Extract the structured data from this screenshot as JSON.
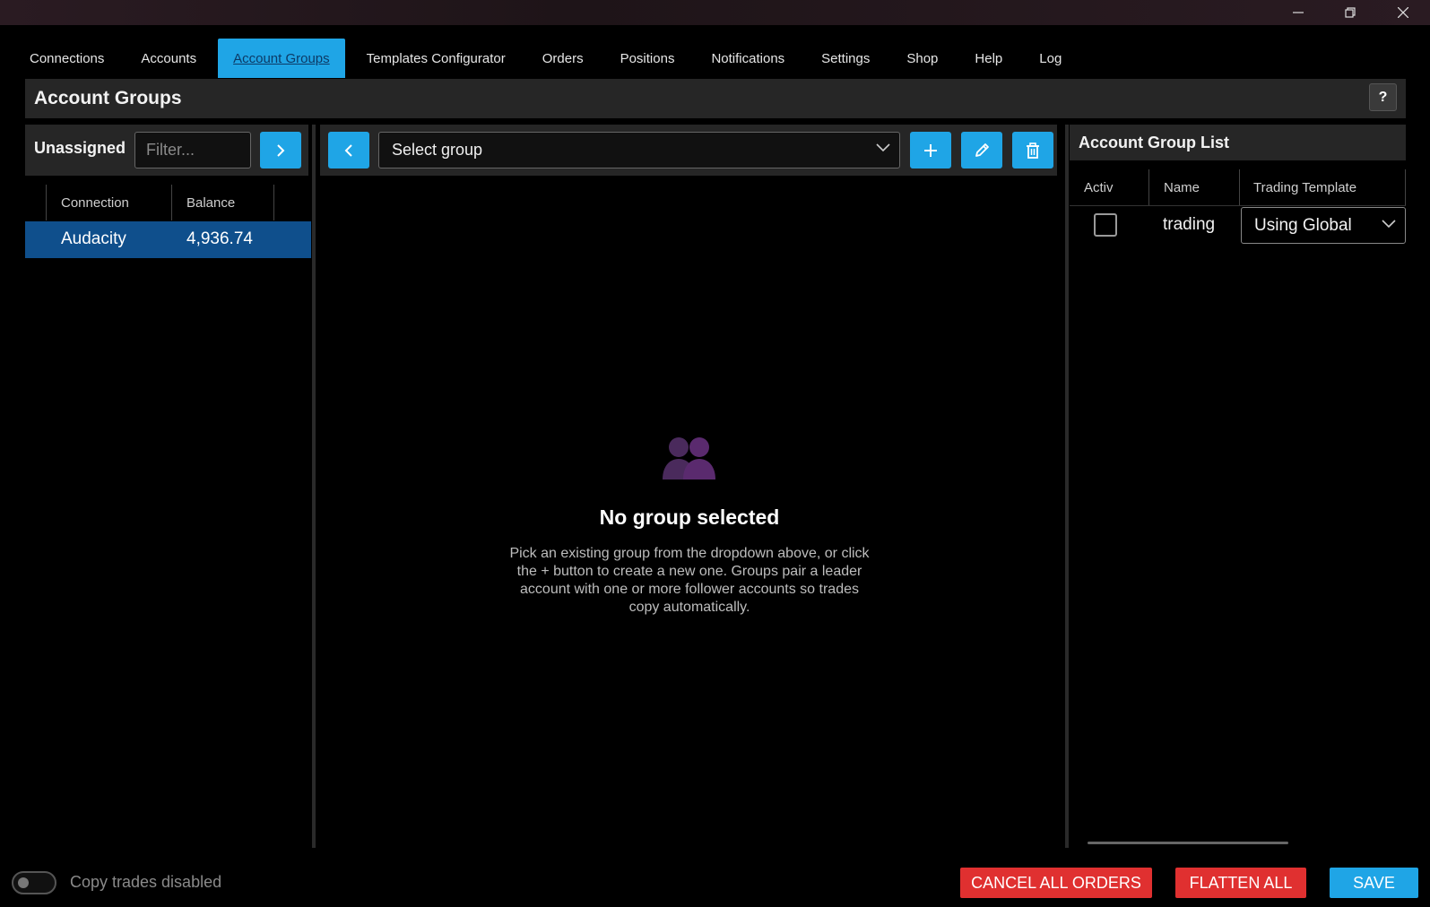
{
  "window": {
    "controls": {
      "minimize": "minimize-icon",
      "restore": "restore-icon",
      "close": "close-icon"
    }
  },
  "tabs": [
    {
      "label": "Connections"
    },
    {
      "label": "Accounts"
    },
    {
      "label": "Account Groups",
      "active": true
    },
    {
      "label": "Templates Configurator"
    },
    {
      "label": "Orders"
    },
    {
      "label": "Positions"
    },
    {
      "label": "Notifications"
    },
    {
      "label": "Settings"
    },
    {
      "label": "Shop"
    },
    {
      "label": "Help"
    },
    {
      "label": "Log"
    }
  ],
  "header": {
    "title": "Account Groups",
    "help_label": "?"
  },
  "unassigned": {
    "label": "Unassigned",
    "filter_placeholder": "Filter...",
    "columns": [
      "Connection",
      "Balance"
    ],
    "rows": [
      {
        "connection": "Audacity",
        "balance": "4,936.74",
        "selected": true
      }
    ]
  },
  "group": {
    "select_placeholder": "Select group",
    "empty_title": "No group selected",
    "empty_desc": "Pick an existing group from the dropdown above, or click the + button to create a new one. Groups pair a leader account with one or more follower accounts so trades copy automatically."
  },
  "group_list": {
    "title": "Account Group List",
    "columns": [
      "Activ",
      "Name",
      "Trading Template"
    ],
    "rows": [
      {
        "active": false,
        "name": "trading",
        "template": "Using Global"
      }
    ]
  },
  "footer": {
    "toggle_label": "Copy trades disabled",
    "toggle_on": false,
    "cancel_all_orders": "CANCEL ALL ORDERS",
    "flatten_all": "FLATTEN ALL",
    "save": "SAVE"
  },
  "colors": {
    "accent": "#1fa5e6",
    "danger": "#e03030",
    "selection": "#0f4f8c",
    "empty_icon": "#5a2a6e"
  }
}
